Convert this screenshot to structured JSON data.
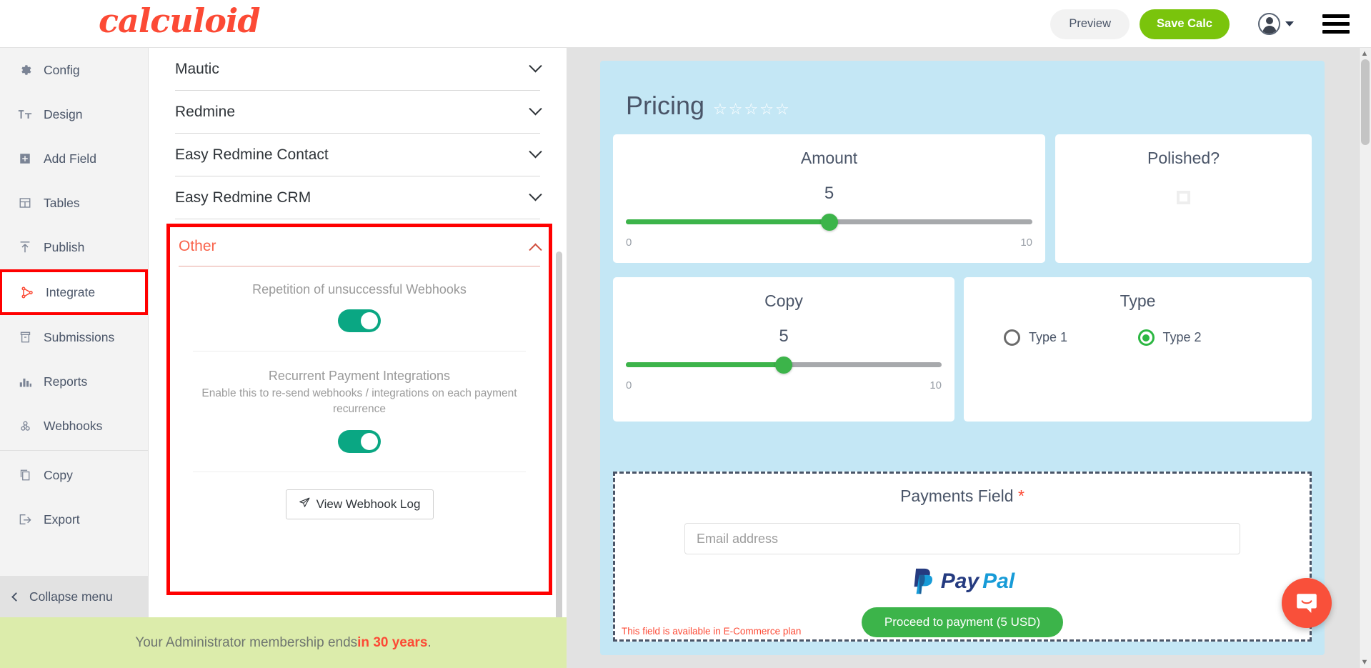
{
  "header": {
    "brand": "calculoid",
    "preview_label": "Preview",
    "save_label": "Save Calc",
    "avatar_icon": "user-avatar-icon",
    "menu_icon": "hamburger-menu-icon"
  },
  "sidebar": {
    "items": [
      {
        "label": "Config",
        "icon": "gear-icon",
        "active": false
      },
      {
        "label": "Design",
        "icon": "text-format-icon",
        "active": false
      },
      {
        "label": "Add Field",
        "icon": "plus-box-icon",
        "active": false
      },
      {
        "label": "Tables",
        "icon": "table-icon",
        "active": false
      },
      {
        "label": "Publish",
        "icon": "upload-icon",
        "active": false
      },
      {
        "label": "Integrate",
        "icon": "integrate-icon",
        "active": true
      },
      {
        "label": "Submissions",
        "icon": "archive-icon",
        "active": false
      },
      {
        "label": "Reports",
        "icon": "bar-chart-icon",
        "active": false
      },
      {
        "label": "Webhooks",
        "icon": "webhook-icon",
        "active": false
      },
      {
        "label": "Copy",
        "icon": "copy-icon",
        "active": false
      },
      {
        "label": "Export",
        "icon": "export-icon",
        "active": false
      }
    ],
    "collapse_label": "Collapse menu",
    "collapse_icon": "chevron-left-icon"
  },
  "integrations": {
    "rows": [
      {
        "label": "Mautic"
      },
      {
        "label": "Redmine"
      },
      {
        "label": "Easy Redmine Contact"
      },
      {
        "label": "Easy Redmine CRM"
      }
    ],
    "other": {
      "title": "Other",
      "options": [
        {
          "label": "Repetition of unsuccessful Webhooks",
          "desc": "",
          "toggle_on": true
        },
        {
          "label": "Recurrent Payment Integrations",
          "desc": "Enable this to re-send webhooks / integrations on each payment recurrence",
          "toggle_on": true
        }
      ],
      "log_button": "View Webhook Log",
      "log_button_icon": "paper-plane-icon"
    },
    "highlight_color": "#ff0000"
  },
  "preview": {
    "title": "Pricing",
    "stars": "☆☆☆☆☆",
    "amount": {
      "title": "Amount",
      "value": "5",
      "min": "0",
      "max": "10",
      "percent": 50
    },
    "polished": {
      "title": "Polished?",
      "checked": false
    },
    "copy": {
      "title": "Copy",
      "value": "5",
      "min": "0",
      "max": "10",
      "percent": 50
    },
    "type": {
      "title": "Type",
      "options": [
        {
          "label": "Type 1",
          "selected": false
        },
        {
          "label": "Type 2",
          "selected": true
        }
      ]
    },
    "payments": {
      "title": "Payments Field",
      "required_marker": "*",
      "email_placeholder": "Email address",
      "email_value": "",
      "provider_pay": "Pay",
      "provider_pal": "Pal",
      "provider_icon": "paypal-logo-icon",
      "proceed_label": "Proceed to payment (5 USD)",
      "plan_note": "This field is available in E-Commerce plan"
    }
  },
  "footer": {
    "text_before": "Your Administrator membership ends ",
    "highlight": "in 30 years",
    "text_after": "."
  },
  "chat": {
    "icon": "chat-bubble-icon"
  },
  "colors": {
    "brand_red": "#fc4a35",
    "save_green": "#7ac40c",
    "toggle_green": "#0aa783",
    "slider_green": "#3cb44a",
    "card_blue": "#c4e7f5",
    "highlight_red": "#ff0000",
    "footer_green": "#dcecab"
  }
}
